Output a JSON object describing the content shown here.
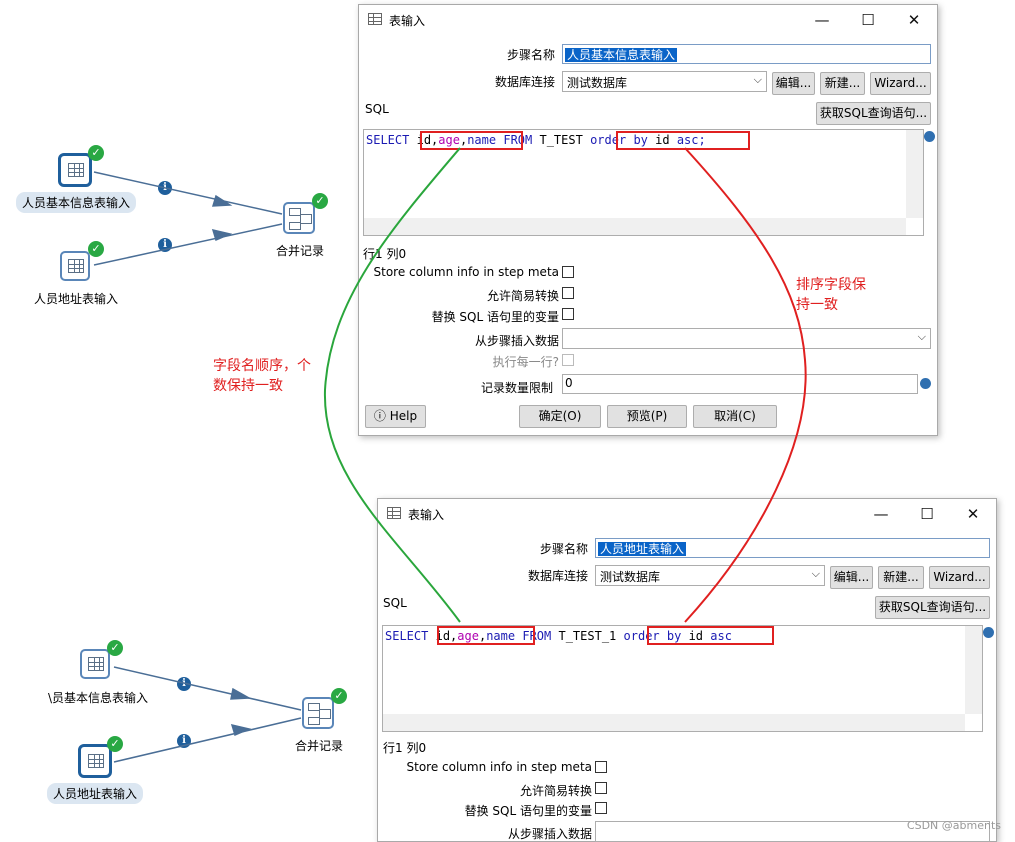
{
  "flow_top": {
    "node1_label": "人员基本信息表输入",
    "node2_label": "人员地址表输入",
    "merge_label": "合并记录",
    "info_glyph": "i",
    "check_glyph": "✓"
  },
  "flow_bottom": {
    "node1_label": "\\员基本信息表输入",
    "node2_label": "人员地址表输入",
    "merge_label": "合并记录",
    "info_glyph": "i",
    "check_glyph": "✓"
  },
  "annotations": {
    "green_note_line1": "字段名顺序，个",
    "green_note_line2": "数保持一致",
    "red_note_line1": "排序字段保",
    "red_note_line2": "持一致",
    "green_color": "#2aa63c",
    "red_color": "#e02020"
  },
  "dialog1": {
    "title": "表输入",
    "win_min": "—",
    "win_max": "☐",
    "win_close": "✕",
    "step_name_label": "步骤名称",
    "step_name_value": "人员基本信息表输入",
    "db_conn_label": "数据库连接",
    "db_conn_value": "测试数据库",
    "edit_btn": "编辑...",
    "new_btn": "新建...",
    "wizard_btn": "Wizard...",
    "sql_label": "SQL",
    "get_sql_btn": "获取SQL查询语句...",
    "sql": {
      "select": "SELECT",
      "f_id": "id,",
      "f_age": "age",
      "f_comma": ",",
      "f_name": "name",
      "from": "FROM",
      "table": "T_TEST",
      "order": "order",
      "by": "by",
      "col": "id",
      "asc": "asc;"
    },
    "row_col": "行1 列0",
    "store_col_info": "Store column info in step meta",
    "allow_lazy": "允许简易转换",
    "replace_vars": "替换 SQL 语句里的变量",
    "insert_from_step": "从步骤插入数据",
    "exec_each_row": "执行每一行?",
    "limit_label": "记录数量限制",
    "limit_value": "0",
    "help_btn": "Help",
    "ok_btn": "确定(O)",
    "preview_btn": "预览(P)",
    "cancel_btn": "取消(C)"
  },
  "dialog2": {
    "title": "表输入",
    "win_min": "—",
    "win_max": "☐",
    "win_close": "✕",
    "step_name_label": "步骤名称",
    "step_name_value": "人员地址表输入",
    "db_conn_label": "数据库连接",
    "db_conn_value": "测试数据库",
    "edit_btn": "编辑...",
    "new_btn": "新建...",
    "wizard_btn": "Wizard...",
    "sql_label": "SQL",
    "get_sql_btn": "获取SQL查询语句...",
    "sql": {
      "select": "SELECT",
      "f_id": "id,",
      "f_age": "age",
      "f_comma": ",",
      "f_name": "name",
      "from": "FROM",
      "table": "T_TEST_1",
      "order": "order",
      "by": "by",
      "col": "id",
      "asc": "asc"
    },
    "row_col": "行1 列0",
    "store_col_info": "Store column info in step meta",
    "allow_lazy": "允许简易转换",
    "replace_vars": "替换 SQL 语句里的变量",
    "insert_from_step": "从步骤插入数据"
  },
  "watermark": "CSDN @abments"
}
